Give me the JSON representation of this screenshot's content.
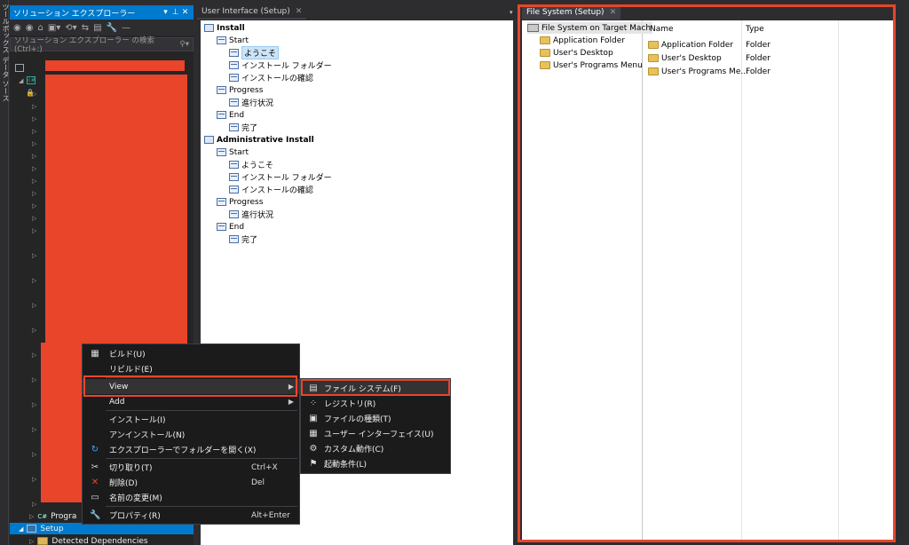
{
  "vertical_strip": {
    "labels": [
      "ツールボックス",
      "データ ソース"
    ]
  },
  "solution_explorer": {
    "title": "ソリューション エクスプローラー",
    "search_placeholder": "ソリューション エクスプローラー の検索 (Ctrl+:)",
    "partial_item_label": "Progra",
    "setup_label": "Setup",
    "detected_dependencies_label": "Detected Dependencies"
  },
  "tabs": {
    "user_interface": "User Interface (Setup)",
    "file_system": "File System (Setup)"
  },
  "ui_tree": {
    "install": {
      "label": "Install",
      "start": {
        "label": "Start",
        "items": [
          "ようこそ",
          "インストール フォルダー",
          "インストールの確認"
        ]
      },
      "progress": {
        "label": "Progress",
        "items": [
          "進行状況"
        ]
      },
      "end": {
        "label": "End",
        "items": [
          "完了"
        ]
      }
    },
    "admin_install": {
      "label": "Administrative Install",
      "start": {
        "label": "Start",
        "items": [
          "ようこそ",
          "インストール フォルダー",
          "インストールの確認"
        ]
      },
      "progress": {
        "label": "Progress",
        "items": [
          "進行状況"
        ]
      },
      "end": {
        "label": "End",
        "items": [
          "完了"
        ]
      }
    }
  },
  "file_system": {
    "root": "File System on Target Mach",
    "folders": [
      "Application Folder",
      "User's Desktop",
      "User's Programs Menu"
    ],
    "columns": {
      "name": "Name",
      "type": "Type"
    },
    "rows": [
      {
        "name": "Application Folder",
        "type": "Folder"
      },
      {
        "name": "User's Desktop",
        "type": "Folder"
      },
      {
        "name": "User's Programs Me...",
        "type": "Folder"
      }
    ]
  },
  "context_menu": {
    "items": [
      {
        "label": "ビルド(U)",
        "icon": "build-icon",
        "shortcut": ""
      },
      {
        "label": "リビルド(E)",
        "icon": "",
        "shortcut": ""
      },
      {
        "label": "View",
        "icon": "",
        "shortcut": ""
      },
      {
        "label": "Add",
        "icon": "",
        "shortcut": ""
      },
      {
        "label": "インストール(I)",
        "icon": "",
        "shortcut": ""
      },
      {
        "label": "アンインストール(N)",
        "icon": "",
        "shortcut": ""
      },
      {
        "label": "エクスプローラーでフォルダーを開く(X)",
        "icon": "refresh-icon",
        "shortcut": ""
      },
      {
        "label": "切り取り(T)",
        "icon": "scissors-icon",
        "shortcut": "Ctrl+X"
      },
      {
        "label": "削除(D)",
        "icon": "delete-icon",
        "shortcut": "Del"
      },
      {
        "label": "名前の変更(M)",
        "icon": "rename-icon",
        "shortcut": ""
      },
      {
        "label": "プロパティ(R)",
        "icon": "wrench-icon",
        "shortcut": "Alt+Enter"
      }
    ]
  },
  "view_submenu": {
    "items": [
      {
        "label": "ファイル システム(F)",
        "icon": "file-system-icon"
      },
      {
        "label": "レジストリ(R)",
        "icon": "registry-icon"
      },
      {
        "label": "ファイルの種類(T)",
        "icon": "file-types-icon"
      },
      {
        "label": "ユーザー インターフェイス(U)",
        "icon": "user-interface-icon"
      },
      {
        "label": "カスタム動作(C)",
        "icon": "custom-action-icon"
      },
      {
        "label": "起動条件(L)",
        "icon": "launch-conditions-icon"
      }
    ]
  },
  "colors": {
    "accent": "#007acc",
    "highlight_box": "#e8452b"
  }
}
